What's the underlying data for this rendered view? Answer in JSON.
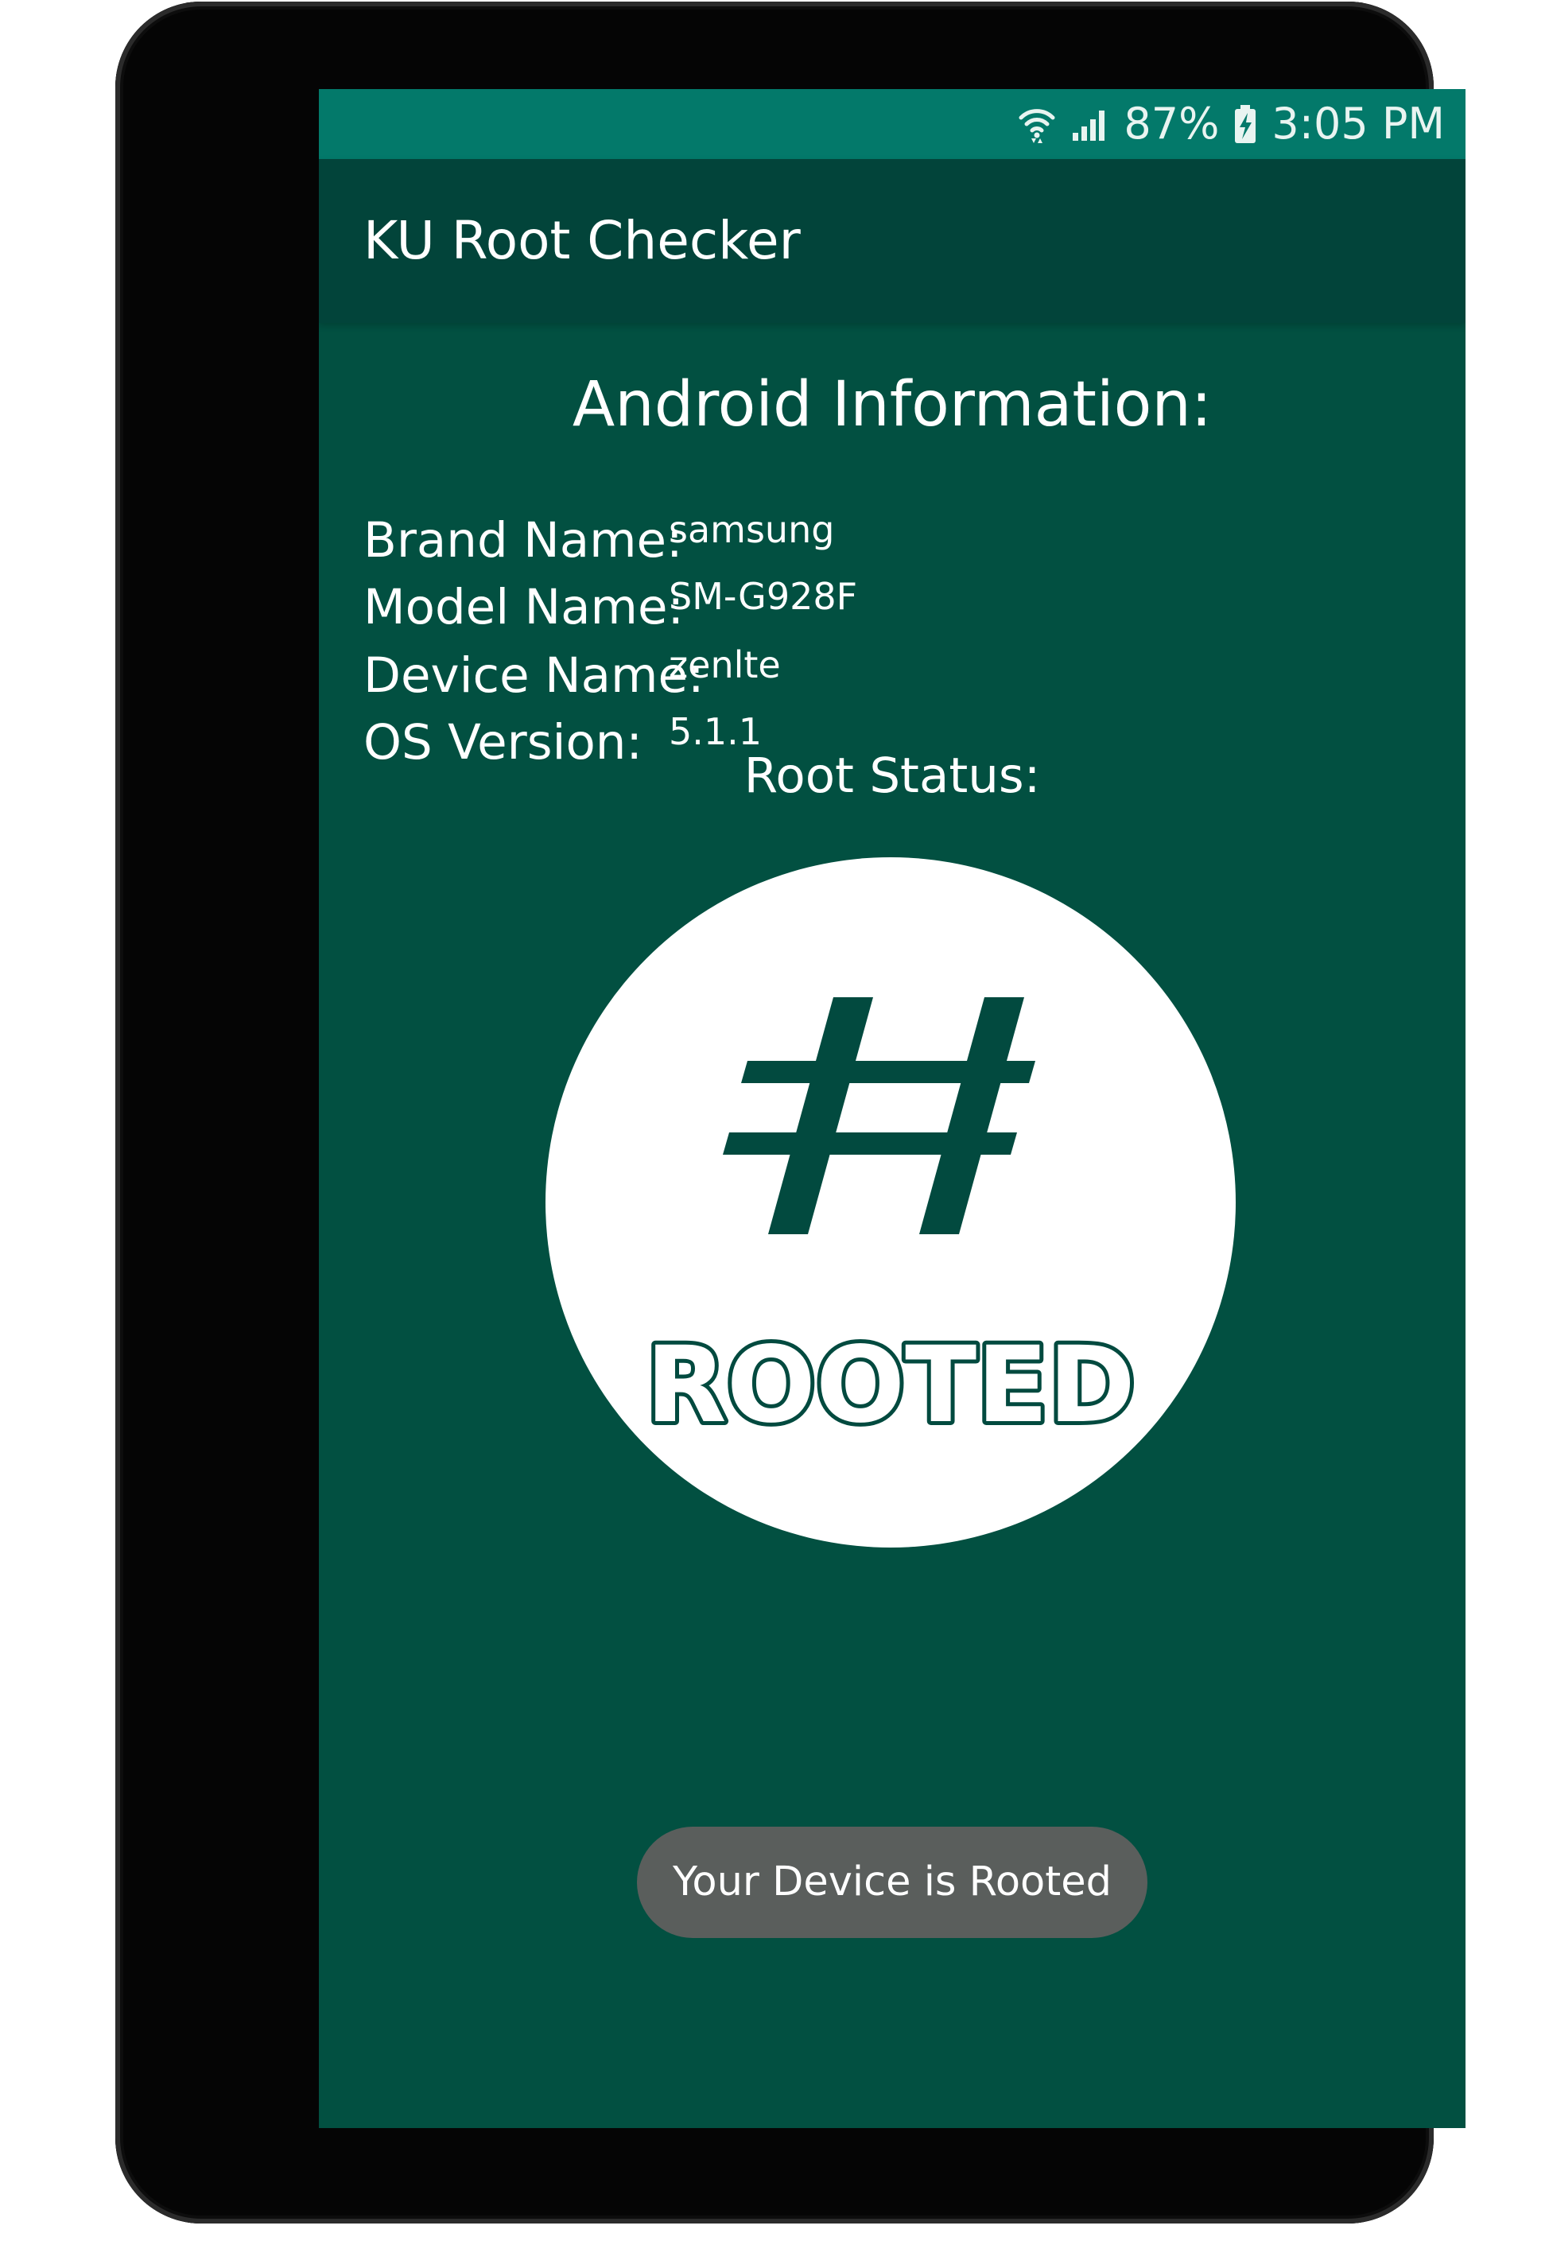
{
  "status_bar": {
    "battery_text": "87%",
    "time_text": "3:05 PM",
    "icons": [
      "wifi-icon",
      "signal-icon",
      "battery-charging-icon"
    ]
  },
  "app_bar": {
    "title": "KU Root Checker"
  },
  "android_info": {
    "heading": "Android Information:",
    "rows": [
      {
        "label": "Brand Name:",
        "value": "samsung"
      },
      {
        "label": "Model Name:",
        "value": "SM-G928F"
      },
      {
        "label": "Device Name:",
        "value": "zenlte"
      },
      {
        "label": "OS Version:",
        "value": "5.1.1"
      }
    ]
  },
  "root_status": {
    "label": "Root Status:",
    "badge_text": "ROOTED",
    "badge_icon": "hash-icon"
  },
  "toast": {
    "message": "Your Device is Rooted"
  },
  "colors": {
    "screen_background": "#025041",
    "app_bar": "#02443a",
    "status_bar": "#03796a",
    "badge_ink": "#024a3f",
    "toast_background": "#5a5e5c"
  }
}
